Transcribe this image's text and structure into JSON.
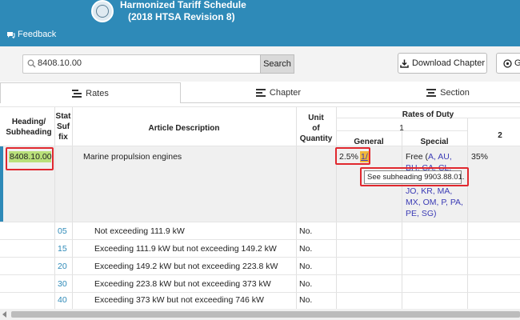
{
  "header": {
    "title_line1": "Harmonized Tariff Schedule",
    "title_line2": "(2018 HTSA Revision 8)",
    "feedback_label": "Feedback"
  },
  "search": {
    "value": "8408.10.00",
    "button_label": "Search",
    "download_label": "Download Chapter",
    "guide_label": "G"
  },
  "tabs": [
    {
      "label": "Rates",
      "icon": "bars-icon"
    },
    {
      "label": "Chapter",
      "icon": "align-left-icon"
    },
    {
      "label": "Section",
      "icon": "align-center-icon"
    }
  ],
  "table": {
    "headers": {
      "heading_line1": "Heading/",
      "heading_line2": "Subheading",
      "stat_line1": "Stat",
      "stat_line2": "Suf",
      "stat_line3": "fix",
      "article": "Article Description",
      "unit_line1": "Unit",
      "unit_line2": "of",
      "unit_line3": "Quantity",
      "rates_of_duty": "Rates of Duty",
      "col1": "1",
      "col2": "2",
      "general": "General",
      "special": "Special"
    },
    "main_row": {
      "heading": "8408.10.00",
      "description": "Marine propulsion engines",
      "general": "2.5%",
      "footnote": "1/",
      "special_prefix": "Free (",
      "special_codes_line1": "A, AU,",
      "special_codes_line2": "BH, CA, CL,",
      "special_codes_line3": "JO, KR, MA,",
      "special_codes_line4": "MX, OM, P, PA,",
      "special_codes_line5": "PE, SG)",
      "col2": "35%",
      "tooltip": "See subheading 9903.88.01."
    },
    "sub_rows": [
      {
        "stat": "05",
        "description": "Not exceeding 111.9 kW",
        "unit": "No."
      },
      {
        "stat": "15",
        "description": "Exceeding 111.9 kW but not exceeding 149.2 kW",
        "unit": "No."
      },
      {
        "stat": "20",
        "description": "Exceeding 149.2 kW but not exceeding 223.8 kW",
        "unit": "No."
      },
      {
        "stat": "30",
        "description": "Exceeding 223.8 kW but not exceeding 373 kW",
        "unit": "No."
      },
      {
        "stat": "40",
        "description": "Exceeding 373 kW but not exceeding 746 kW",
        "unit": "No."
      }
    ]
  },
  "colors": {
    "brand": "#2e8ab8",
    "highlight_green": "#b9e07a",
    "highlight_orange": "#f0b83a",
    "annotation_red": "#e0282f",
    "link_blue": "#3b3bb5"
  }
}
